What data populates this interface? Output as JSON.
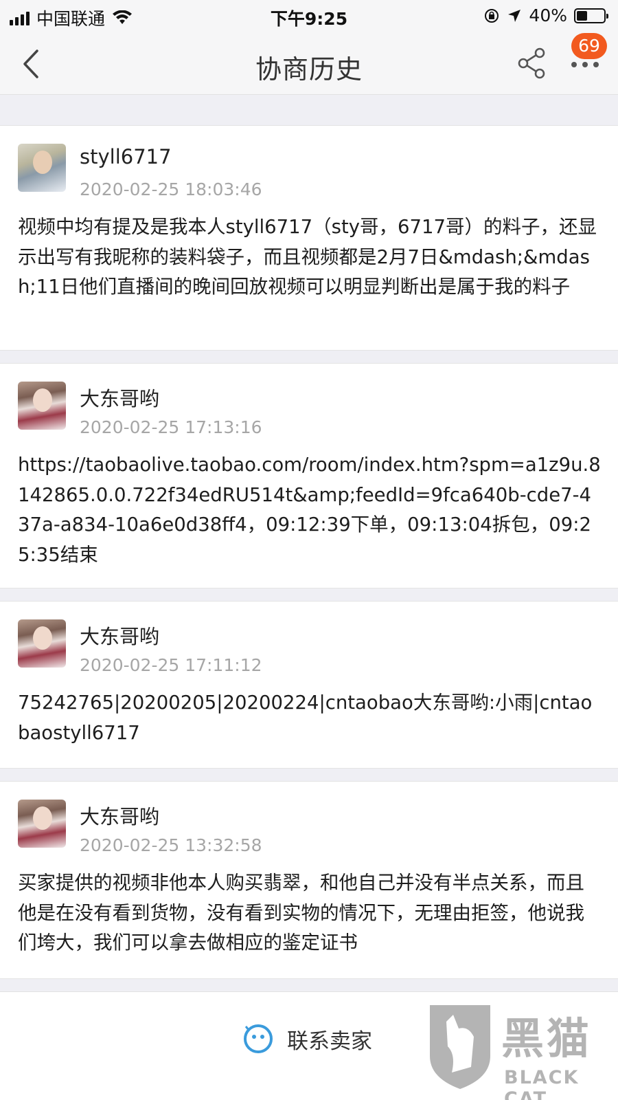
{
  "status_bar": {
    "carrier": "中国联通",
    "time": "下午9:25",
    "battery_text": "40%",
    "battery_level": 0.4
  },
  "nav": {
    "title": "协商历史",
    "badge_count": "69"
  },
  "records": [
    {
      "user": "styll6717",
      "time": "2020-02-25 18:03:46",
      "message": "视频中均有提及是我本人styll6717（sty哥，6717哥）的料子，还显示出写有我昵称的装料袋子，而且视频都是2月7日&mdash;&mdash;11日他们直播间的晚间回放视频可以明显判断出是属于我的料子"
    },
    {
      "user": "大东哥哟",
      "time": "2020-02-25 17:13:16",
      "message": "https://taobaolive.taobao.com/room/index.htm?spm=a1z9u.8142865.0.0.722f34edRU514t&amp;feedId=9fca640b-cde7-437a-a834-10a6e0d38ff4，09:12:39下单，09:13:04拆包，09:25:35结束"
    },
    {
      "user": "大东哥哟",
      "time": "2020-02-25 17:11:12",
      "message": "75242765|20200205|20200224|cntaobao大东哥哟:小雨|cntaobaostyll6717"
    },
    {
      "user": "大东哥哟",
      "time": "2020-02-25 13:32:58",
      "message": "买家提供的视频非他本人购买翡翠，和他自己并没有半点关系，而且他是在没有看到货物，没有看到实物的情况下，无理由拒签，他说我们垮大，我们可以拿去做相应的鉴定证书"
    }
  ],
  "bottom": {
    "contact_label": "联系卖家"
  },
  "watermark": {
    "title": "黑猫",
    "subtitle": "BLACK CAT"
  },
  "colors": {
    "badge": "#f25a1f",
    "contact_icon": "#3a9bdc"
  }
}
